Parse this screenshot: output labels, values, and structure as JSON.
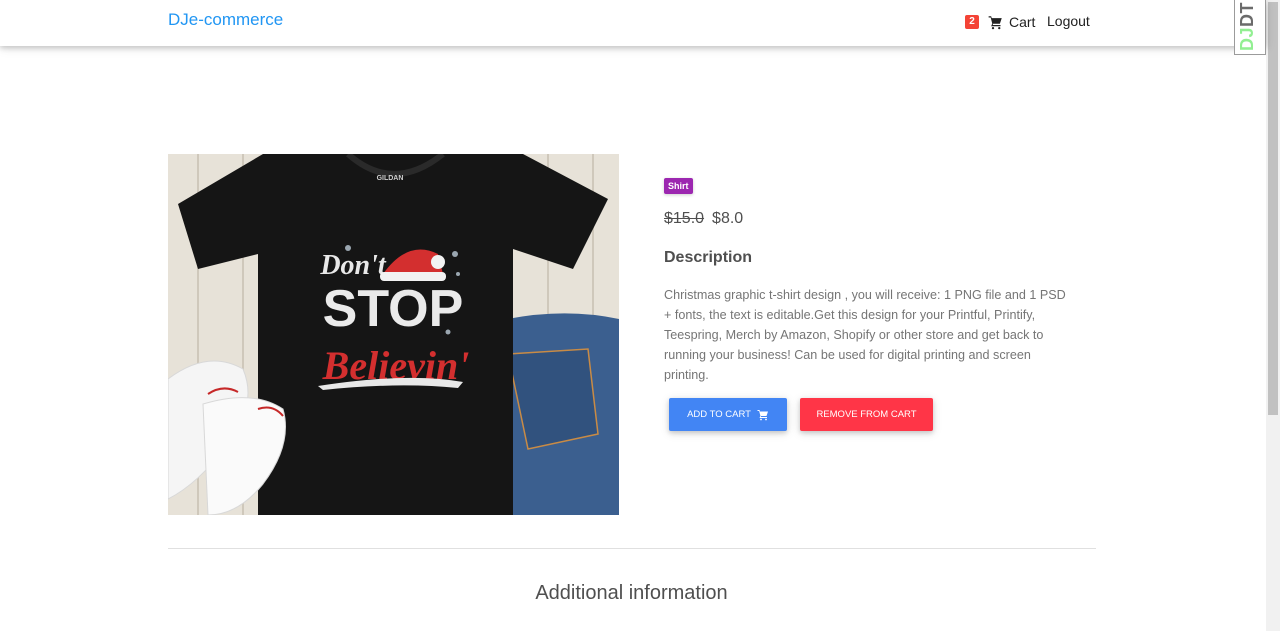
{
  "navbar": {
    "brand": "DJe-commerce",
    "cart_count": "2",
    "cart_label": "Cart",
    "logout_label": "Logout"
  },
  "debug_toolbar": {
    "dj": "DJ",
    "dt": "DT"
  },
  "product": {
    "category": "Shirt",
    "old_price": "$15.0",
    "price": "$8.0",
    "description_heading": "Description",
    "description": "Christmas graphic t-shirt design , you will receive: 1 PNG file and 1 PSD + fonts, the text is editable.Get this design for your Printful, Printify, Teespring, Merch by Amazon, Shopify or other store and get back to running your business! Can be used for digital printing and screen printing.",
    "shirt_print": {
      "line1": "Don't",
      "line2": "STOP",
      "line3": "Believin'",
      "tag": "GILDAN"
    },
    "add_to_cart_label": "Add to cart",
    "remove_from_cart_label": "Remove from cart"
  },
  "additional": {
    "heading": "Additional information"
  },
  "colors": {
    "brand": "#2196f3",
    "badge_red": "#f44336",
    "category_purple": "#9c27b0",
    "add_blue": "#4285f4",
    "remove_red": "#ff3547"
  },
  "icons": [
    "shopping-cart-icon",
    "shopping-cart-icon"
  ]
}
